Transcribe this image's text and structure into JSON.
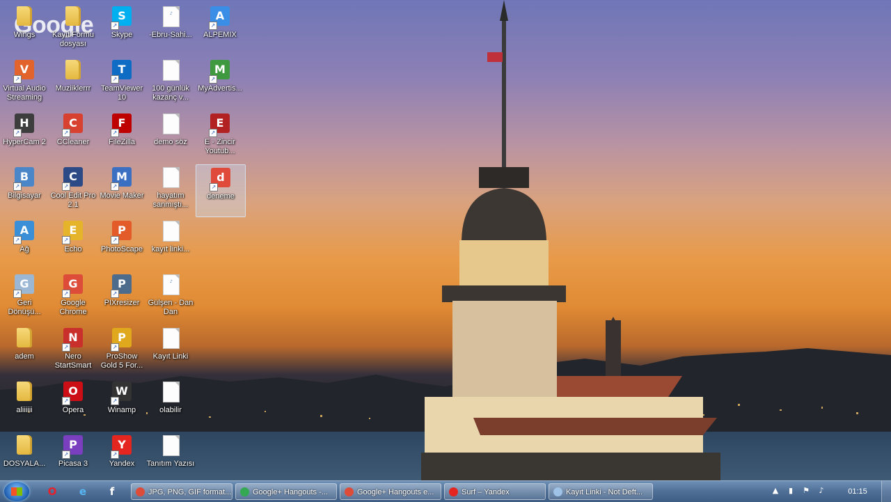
{
  "watermark": "Google",
  "desktop": {
    "icons": [
      {
        "label": "Wings",
        "type": "folder"
      },
      {
        "label": "Virtual Audio Streaming",
        "type": "app",
        "color": "#e2632b"
      },
      {
        "label": "HyperCam 2",
        "type": "app",
        "color": "#3d3d3d"
      },
      {
        "label": "Bilgisayar",
        "type": "app",
        "color": "#4b86c9"
      },
      {
        "label": "Ağ",
        "type": "app",
        "color": "#3b8fd6"
      },
      {
        "label": "Geri Dönüşü...",
        "type": "app",
        "color": "#9bb7d4"
      },
      {
        "label": "adem",
        "type": "folder"
      },
      {
        "label": "aliiiiii",
        "type": "folder"
      },
      {
        "label": "DOSYALA...",
        "type": "folder"
      },
      {
        "label": "Kayıt Formu dosyası",
        "type": "folder"
      },
      {
        "label": "Muziiklerrr",
        "type": "folder"
      },
      {
        "label": "CCleaner",
        "type": "app",
        "color": "#d8402f"
      },
      {
        "label": "Cool Edit Pro 2.1",
        "type": "app",
        "color": "#2c4a86"
      },
      {
        "label": "Echo",
        "type": "app",
        "color": "#e6b42a"
      },
      {
        "label": "Google Chrome",
        "type": "app",
        "color": "#dd4b39"
      },
      {
        "label": "Nero StartSmart",
        "type": "app",
        "color": "#c9302c"
      },
      {
        "label": "Opera",
        "type": "app",
        "color": "#cc0f16"
      },
      {
        "label": "Picasa 3",
        "type": "app",
        "color": "#7a3fbf"
      },
      {
        "label": "Skype",
        "type": "app",
        "color": "#00aff0"
      },
      {
        "label": "TeamViewer 10",
        "type": "app",
        "color": "#0e6cc4"
      },
      {
        "label": "FileZilla",
        "type": "app",
        "color": "#bf0000"
      },
      {
        "label": "Movie Maker",
        "type": "app",
        "color": "#3a6fc2"
      },
      {
        "label": "PhotoScape",
        "type": "app",
        "color": "#e45b2a"
      },
      {
        "label": "PIXresizer",
        "type": "app",
        "color": "#4d6b8a"
      },
      {
        "label": "ProShow Gold 5 For...",
        "type": "app",
        "color": "#e0a81c"
      },
      {
        "label": "Winamp",
        "type": "app",
        "color": "#333333"
      },
      {
        "label": "Yandex",
        "type": "app",
        "color": "#e52620"
      },
      {
        "label": "-Ebru-Sahi...",
        "type": "mp3"
      },
      {
        "label": "100 günlük kazanç v...",
        "type": "doc"
      },
      {
        "label": "demo söz",
        "type": "doc"
      },
      {
        "label": "hayatım sanmıştı...",
        "type": "doc"
      },
      {
        "label": "kayıt linki...",
        "type": "doc"
      },
      {
        "label": "Gülşen - Dan Dan",
        "type": "mp3"
      },
      {
        "label": "Kayıt Linki",
        "type": "doc"
      },
      {
        "label": "olabilir",
        "type": "doc"
      },
      {
        "label": "Tanıtım Yazısı",
        "type": "doc"
      },
      {
        "label": "ALPEMIX",
        "type": "app",
        "color": "#3a8ee6"
      },
      {
        "label": "MyAdvertis...",
        "type": "app",
        "color": "#3f9a3f"
      },
      {
        "label": "E - Zincir Youtub...",
        "type": "app",
        "color": "#b22222"
      },
      {
        "label": "deneme",
        "type": "app",
        "color": "#e04a3a",
        "selected": true
      }
    ]
  },
  "taskbar": {
    "start_label": "Start",
    "pinned": [
      {
        "name": "opera",
        "glyph": "O",
        "color": "#e8202a"
      },
      {
        "name": "internet-explorer",
        "glyph": "e",
        "color": "#58b7f2"
      },
      {
        "name": "facebook",
        "glyph": "f",
        "color": "#ffffff"
      }
    ],
    "tasks": [
      {
        "label": "JPG, PNG, GIF format...",
        "color": "#dd4b39"
      },
      {
        "label": "Google+ Hangouts -...",
        "color": "#34a853"
      },
      {
        "label": "Google+ Hangouts e...",
        "color": "#dd4b39"
      },
      {
        "label": "Surf – Yandex",
        "color": "#e52620"
      },
      {
        "label": "Kayıt Linki - Not Deft...",
        "color": "#9ec3e6"
      }
    ],
    "clock": "01:15"
  }
}
